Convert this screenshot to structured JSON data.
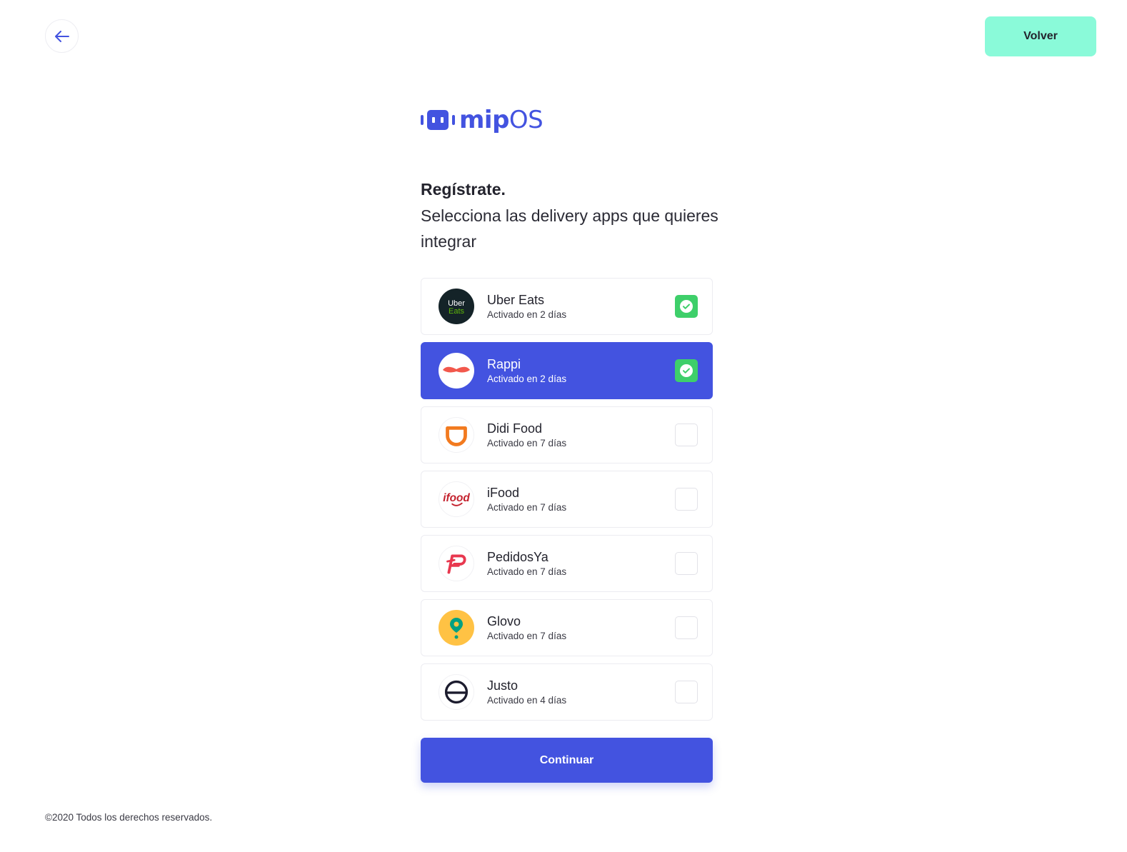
{
  "header": {
    "back_icon": "arrow-left-icon",
    "volver_label": "Volver"
  },
  "logo": {
    "bold": "mip",
    "light": "OS"
  },
  "heading": {
    "title": "Regístrate.",
    "subtitle": "Selecciona las delivery apps que quieres integrar"
  },
  "apps": [
    {
      "name": "Uber Eats",
      "sub": "Activado en 2 días",
      "checked": true,
      "active": false,
      "logo_icon": "uber-eats-logo",
      "logo_text_1": "Uber",
      "logo_text_2": "Eats"
    },
    {
      "name": "Rappi",
      "sub": "Activado en 2 días",
      "checked": true,
      "active": true,
      "logo_icon": "rappi-logo"
    },
    {
      "name": "Didi Food",
      "sub": "Activado en 7 días",
      "checked": false,
      "active": false,
      "logo_icon": "didi-food-logo"
    },
    {
      "name": "iFood",
      "sub": "Activado en 7 días",
      "checked": false,
      "active": false,
      "logo_icon": "ifood-logo",
      "logo_text": "ifood"
    },
    {
      "name": "PedidosYa",
      "sub": "Activado en 7 días",
      "checked": false,
      "active": false,
      "logo_icon": "pedidosya-logo"
    },
    {
      "name": "Glovo",
      "sub": "Activado en 7 días",
      "checked": false,
      "active": false,
      "logo_icon": "glovo-logo"
    },
    {
      "name": "Justo",
      "sub": "Activado en 4 días",
      "checked": false,
      "active": false,
      "logo_icon": "justo-logo"
    }
  ],
  "continue_label": "Continuar",
  "footer": "©2020 Todos los derechos reservados.",
  "colors": {
    "primary": "#4353e0",
    "accent": "#8afad9",
    "check": "#3ecf6a"
  }
}
